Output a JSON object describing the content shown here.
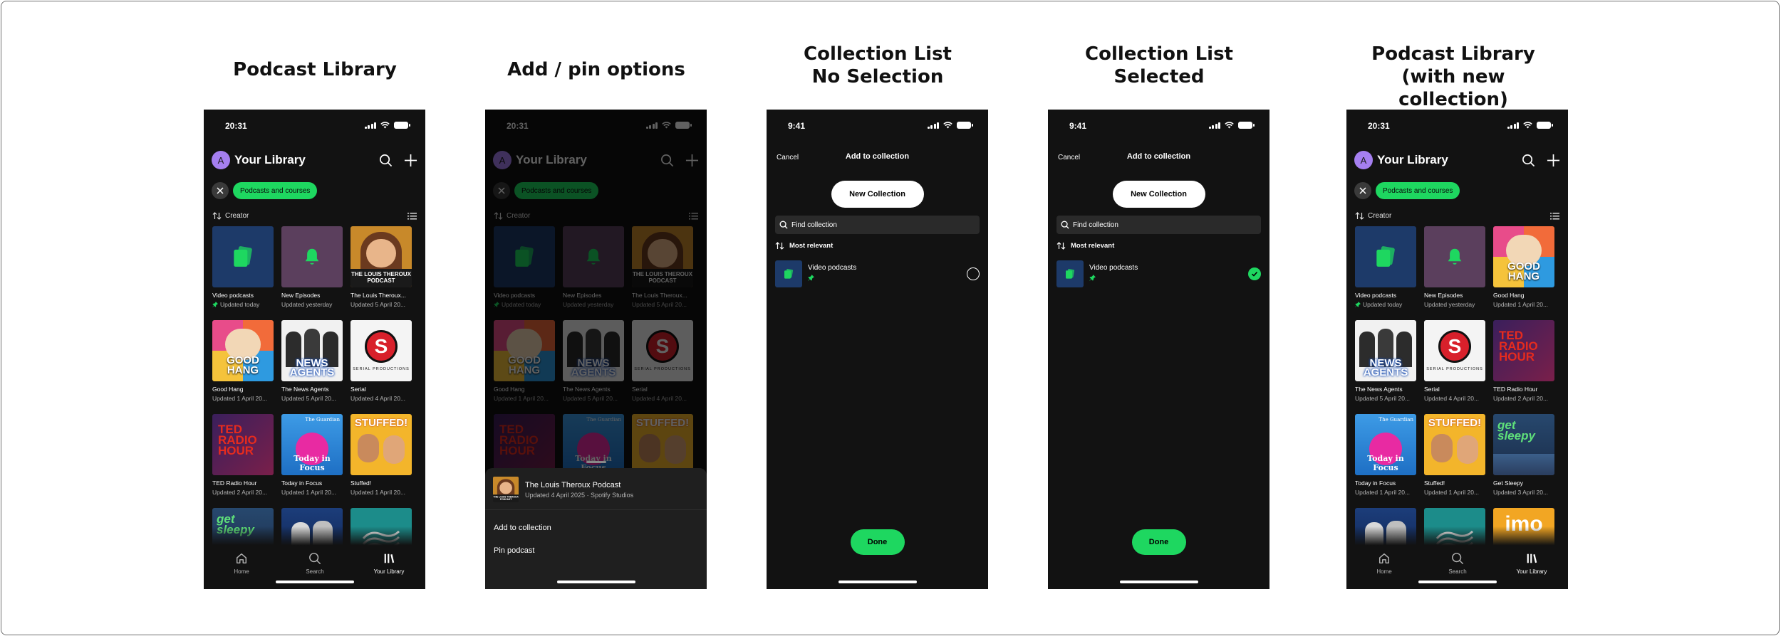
{
  "titles": [
    "Podcast Library",
    "Add / pin options",
    "Collection List\nNo Selection",
    "Collection List\nSelected",
    "Podcast Library\n(with new collection)"
  ],
  "colors": {
    "accent": "#1ed760",
    "background": "#121212",
    "avatar": "#a57ff0",
    "collection_blue": "#1d3a69"
  },
  "status_time": {
    "library": "20:31",
    "modal": "9:41"
  },
  "library": {
    "avatar_letter": "A",
    "title": "Your Library",
    "chip": "Podcasts and courses",
    "sort_label": "Creator",
    "nav": {
      "home": "Home",
      "search": "Search",
      "library": "Your Library"
    }
  },
  "screen1_tiles": [
    {
      "art": "video",
      "name": "Video podcasts",
      "sub": "Updated today",
      "pinned": true
    },
    {
      "art": "bell",
      "name": "New Episodes",
      "sub": "Updated yesterday",
      "pinned": false
    },
    {
      "art": "louis",
      "name": "The Louis Theroux...",
      "sub": "Updated 5 April 20...",
      "pinned": false
    },
    {
      "art": "goodhang",
      "name": "Good Hang",
      "sub": "Updated 1 April 20...",
      "pinned": false
    },
    {
      "art": "newsagents",
      "name": "The News Agents",
      "sub": "Updated 5 April 20...",
      "pinned": false
    },
    {
      "art": "serial",
      "name": "Serial",
      "sub": "Updated 4 April 20...",
      "pinned": false
    },
    {
      "art": "ted",
      "name": "TED Radio Hour",
      "sub": "Updated 2 April 20...",
      "pinned": false
    },
    {
      "art": "tif",
      "name": "Today in Focus",
      "sub": "Updated 1 April 20...",
      "pinned": false
    },
    {
      "art": "stuffed",
      "name": "Stuffed!",
      "sub": "Updated 1 April 20...",
      "pinned": false
    },
    {
      "art": "sleepy",
      "name": "",
      "sub": "",
      "pinned": false
    },
    {
      "art": "history",
      "name": "",
      "sub": "",
      "pinned": false
    },
    {
      "art": "wave",
      "name": "",
      "sub": "",
      "pinned": false
    }
  ],
  "screen5_tiles": [
    {
      "art": "video",
      "name": "Video podcasts",
      "sub": "Updated today",
      "pinned": true
    },
    {
      "art": "bell",
      "name": "New Episodes",
      "sub": "Updated yesterday",
      "pinned": false
    },
    {
      "art": "goodhang",
      "name": "Good Hang",
      "sub": "Updated 1 April 20...",
      "pinned": false
    },
    {
      "art": "newsagents",
      "name": "The News Agents",
      "sub": "Updated 5 April 20...",
      "pinned": false
    },
    {
      "art": "serial",
      "name": "Serial",
      "sub": "Updated 4 April 20...",
      "pinned": false
    },
    {
      "art": "ted",
      "name": "TED Radio Hour",
      "sub": "Updated 2 April 20...",
      "pinned": false
    },
    {
      "art": "tif",
      "name": "Today in Focus",
      "sub": "Updated 1 April 20...",
      "pinned": false
    },
    {
      "art": "stuffed",
      "name": "Stuffed!",
      "sub": "Updated 1 April 20...",
      "pinned": false
    },
    {
      "art": "sleepy",
      "name": "Get Sleepy",
      "sub": "Updated 3 April 20...",
      "pinned": false
    },
    {
      "art": "history",
      "name": "",
      "sub": "",
      "pinned": false
    },
    {
      "art": "wave",
      "name": "",
      "sub": "",
      "pinned": false
    },
    {
      "art": "imo",
      "name": "",
      "sub": "",
      "pinned": false
    }
  ],
  "sheet": {
    "podcast_title": "The Louis Theroux Podcast",
    "podcast_sub": "Updated 4 April 2025 · Spotify Studios",
    "add_label": "Add to collection",
    "pin_label": "Pin podcast"
  },
  "modal": {
    "cancel": "Cancel",
    "title": "Add to collection",
    "new_collection": "New Collection",
    "find_placeholder": "Find collection",
    "most_relevant": "Most relevant",
    "collection_name": "Video podcasts",
    "done": "Done"
  },
  "art_text": {
    "louis": "THE LOUIS THEROUX PODCAST",
    "goodhang": "GOOD HANG",
    "news_top": "THE",
    "news_main": "NEWS AGENTS",
    "serial_letter": "S",
    "serial_sub": "SERIAL PRODUCTIONS",
    "ted": "TED RADIO HOUR",
    "tif_brand": "The Guardian",
    "tif": "Today in Focus",
    "stuffed": "STUFFED!",
    "sleepy": "get sleepy",
    "imo": "imo"
  }
}
